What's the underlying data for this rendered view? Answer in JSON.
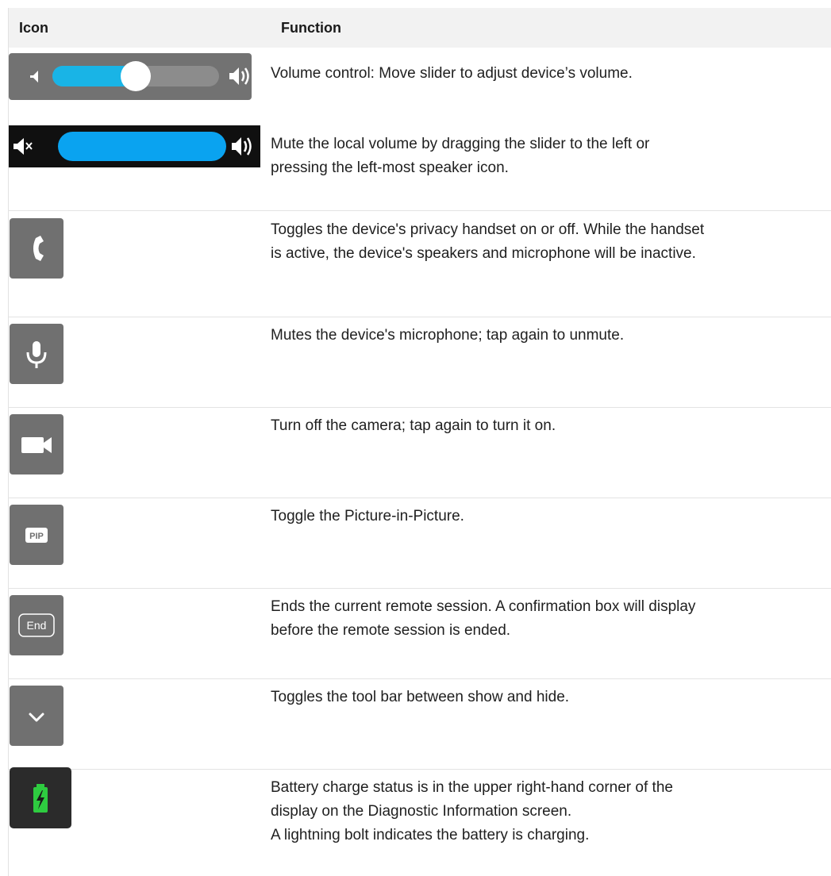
{
  "header": {
    "col_icon": "Icon",
    "col_function": "Function"
  },
  "rows": [
    {
      "icon": "volume-slider-icon",
      "text": [
        "Volume control: Move slider to adjust device’s volume."
      ]
    },
    {
      "icon": "volume-mute-slider-icon",
      "text": [
        "Mute the local volume by dragging the slider to the left or",
        "pressing the left-most speaker icon."
      ]
    },
    {
      "icon": "phone-handset-icon",
      "text": [
        "Toggles the device's privacy handset on or off. While the handset",
        "is active, the device's speakers and microphone will be inactive."
      ]
    },
    {
      "icon": "microphone-icon",
      "text": [
        "Mutes the device's microphone; tap again to unmute."
      ]
    },
    {
      "icon": "video-camera-icon",
      "text": [
        "Turn off the camera; tap again to turn it on."
      ]
    },
    {
      "icon": "pip-icon",
      "icon_label": "PIP",
      "text": [
        "Toggle the Picture-in-Picture."
      ]
    },
    {
      "icon": "end-session-icon",
      "icon_label": "End",
      "text": [
        "Ends the current remote session. A confirmation box will display",
        "before the remote session is ended."
      ]
    },
    {
      "icon": "chevron-down-icon",
      "text": [
        "Toggles the tool bar between show and hide."
      ]
    },
    {
      "icon": "battery-charging-icon",
      "text": [
        "Battery charge status is in the upper right-hand corner of the",
        "display on the Diagnostic Information screen.",
        "A lightning bolt indicates the battery is charging."
      ]
    }
  ],
  "volume": {
    "level": 0.5,
    "track_color": "#19b4e6",
    "mute_track_color": "#0aa3f0"
  },
  "colors": {
    "icon_bg": "#707070",
    "battery_green": "#2ecc40",
    "header_bg": "#f2f2f2"
  }
}
